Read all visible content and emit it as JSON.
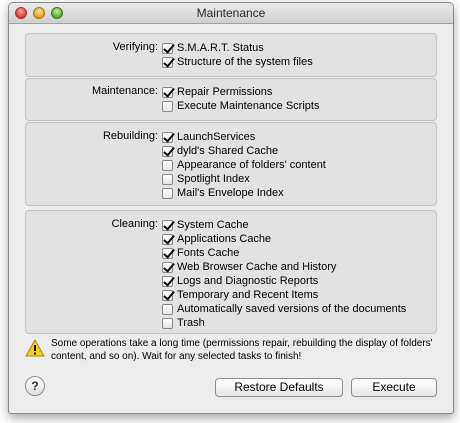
{
  "window": {
    "title": "Maintenance"
  },
  "groups": [
    {
      "label": "Verifying:",
      "items": [
        {
          "label": "S.M.A.R.T. Status",
          "checked": true
        },
        {
          "label": "Structure of the system files",
          "checked": true
        }
      ]
    },
    {
      "label": "Maintenance:",
      "items": [
        {
          "label": "Repair Permissions",
          "checked": true
        },
        {
          "label": "Execute Maintenance Scripts",
          "checked": false
        }
      ]
    },
    {
      "label": "Rebuilding:",
      "items": [
        {
          "label": "LaunchServices",
          "checked": true
        },
        {
          "label": "dyld's Shared Cache",
          "checked": true
        },
        {
          "label": "Appearance of folders' content",
          "checked": false
        },
        {
          "label": "Spotlight Index",
          "checked": false
        },
        {
          "label": "Mail's Envelope Index",
          "checked": false
        }
      ]
    },
    {
      "label": "Cleaning:",
      "items": [
        {
          "label": "System Cache",
          "checked": true
        },
        {
          "label": "Applications Cache",
          "checked": true
        },
        {
          "label": "Fonts Cache",
          "checked": true
        },
        {
          "label": "Web Browser Cache and History",
          "checked": true
        },
        {
          "label": "Logs and Diagnostic Reports",
          "checked": true
        },
        {
          "label": "Temporary and Recent Items",
          "checked": true
        },
        {
          "label": "Automatically saved versions of the documents",
          "checked": false
        },
        {
          "label": "Trash",
          "checked": false
        }
      ]
    }
  ],
  "notice": {
    "text": "Some operations take a long time (permissions repair, rebuilding the display of folders' content, and so on). Wait for any selected tasks to finish!",
    "icon": "warning-icon"
  },
  "footer": {
    "help_label": "?",
    "restore_label": "Restore Defaults",
    "execute_label": "Execute"
  }
}
